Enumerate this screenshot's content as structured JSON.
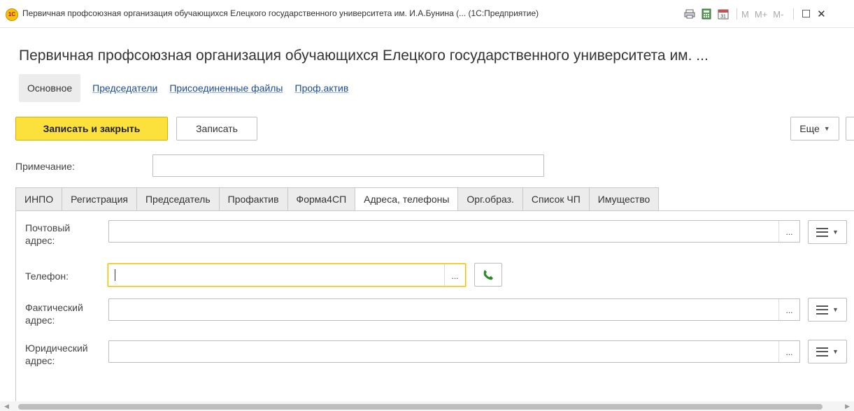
{
  "window": {
    "title": "Первичная профсоюзная организация обучающихся Елецкого государственного университета им. И.А.Бунина (... (1С:Предприятие)",
    "logo_text": "1С",
    "m_buttons": [
      "M",
      "M+",
      "M-"
    ],
    "restore_glyph": "☐",
    "close_glyph": "✕"
  },
  "page": {
    "title": "Первичная профсоюзная организация обучающихся Елецкого государственного университета им. ..."
  },
  "sections": {
    "active": "Основное",
    "links": [
      "Председатели",
      "Присоединенные файлы",
      "Проф.актив"
    ]
  },
  "commands": {
    "save_close": "Записать и закрыть",
    "save": "Записать",
    "more": "Еще"
  },
  "note": {
    "label": "Примечание:",
    "value": ""
  },
  "tabs": {
    "items": [
      "ИНПО",
      "Регистрация",
      "Председатель",
      "Профактив",
      "Форма4СП",
      "Адреса, телефоны",
      "Орг.образ.",
      "Список ЧП",
      "Имущество"
    ],
    "active_index": 5
  },
  "fields": {
    "postal_label_1": "Почтовый",
    "postal_label_2": "адрес:",
    "postal_value": "",
    "phone_label": "Телефон:",
    "phone_value": "",
    "actual_label_1": "Фактический",
    "actual_label_2": "адрес:",
    "actual_value": "",
    "legal_label_1": "Юридический",
    "legal_label_2": "адрес:",
    "legal_value": "",
    "dots": "..."
  },
  "icons": {
    "phone": "phone-icon",
    "menu": "hamburger-icon",
    "dropdown": "chevron-down-icon"
  }
}
